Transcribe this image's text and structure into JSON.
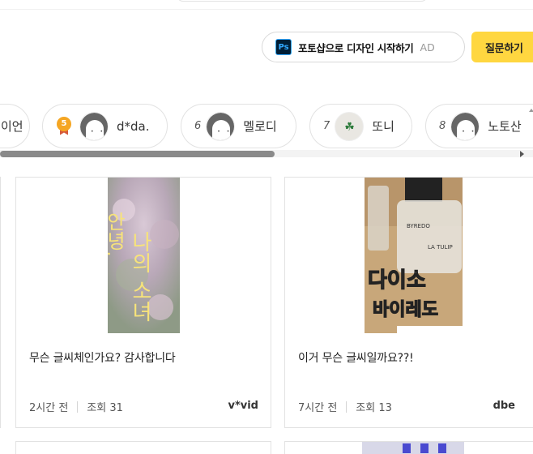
{
  "ad": {
    "icon_label": "Ps",
    "text": "포토샵으로 디자인 시작하기",
    "tag": "AD"
  },
  "ask_button": {
    "label": "질문하기"
  },
  "ranking": [
    {
      "rank": "",
      "name": "이언"
    },
    {
      "rank": "5",
      "name": "d*da.",
      "medal": true
    },
    {
      "rank": "6",
      "name": "멜로디"
    },
    {
      "rank": "7",
      "name": "또니",
      "avatar": "clover"
    },
    {
      "rank": "8",
      "name": "노토산"
    }
  ],
  "cards": [
    {
      "image_text": "안녕, 나의 소녀",
      "title": "무슨 글씨체인가요? 감사합니다",
      "time": "2시간 전",
      "views": "조회 31",
      "author": "v*vid"
    },
    {
      "image_text_top": "다이소",
      "image_text_bottom": "바이레도",
      "image_label": "BYREDO",
      "image_label2": "LA TULIP",
      "title": "이거 무슨 글씨일까요??!",
      "time": "7시간 전",
      "views": "조회 13",
      "author": "dbe"
    }
  ]
}
